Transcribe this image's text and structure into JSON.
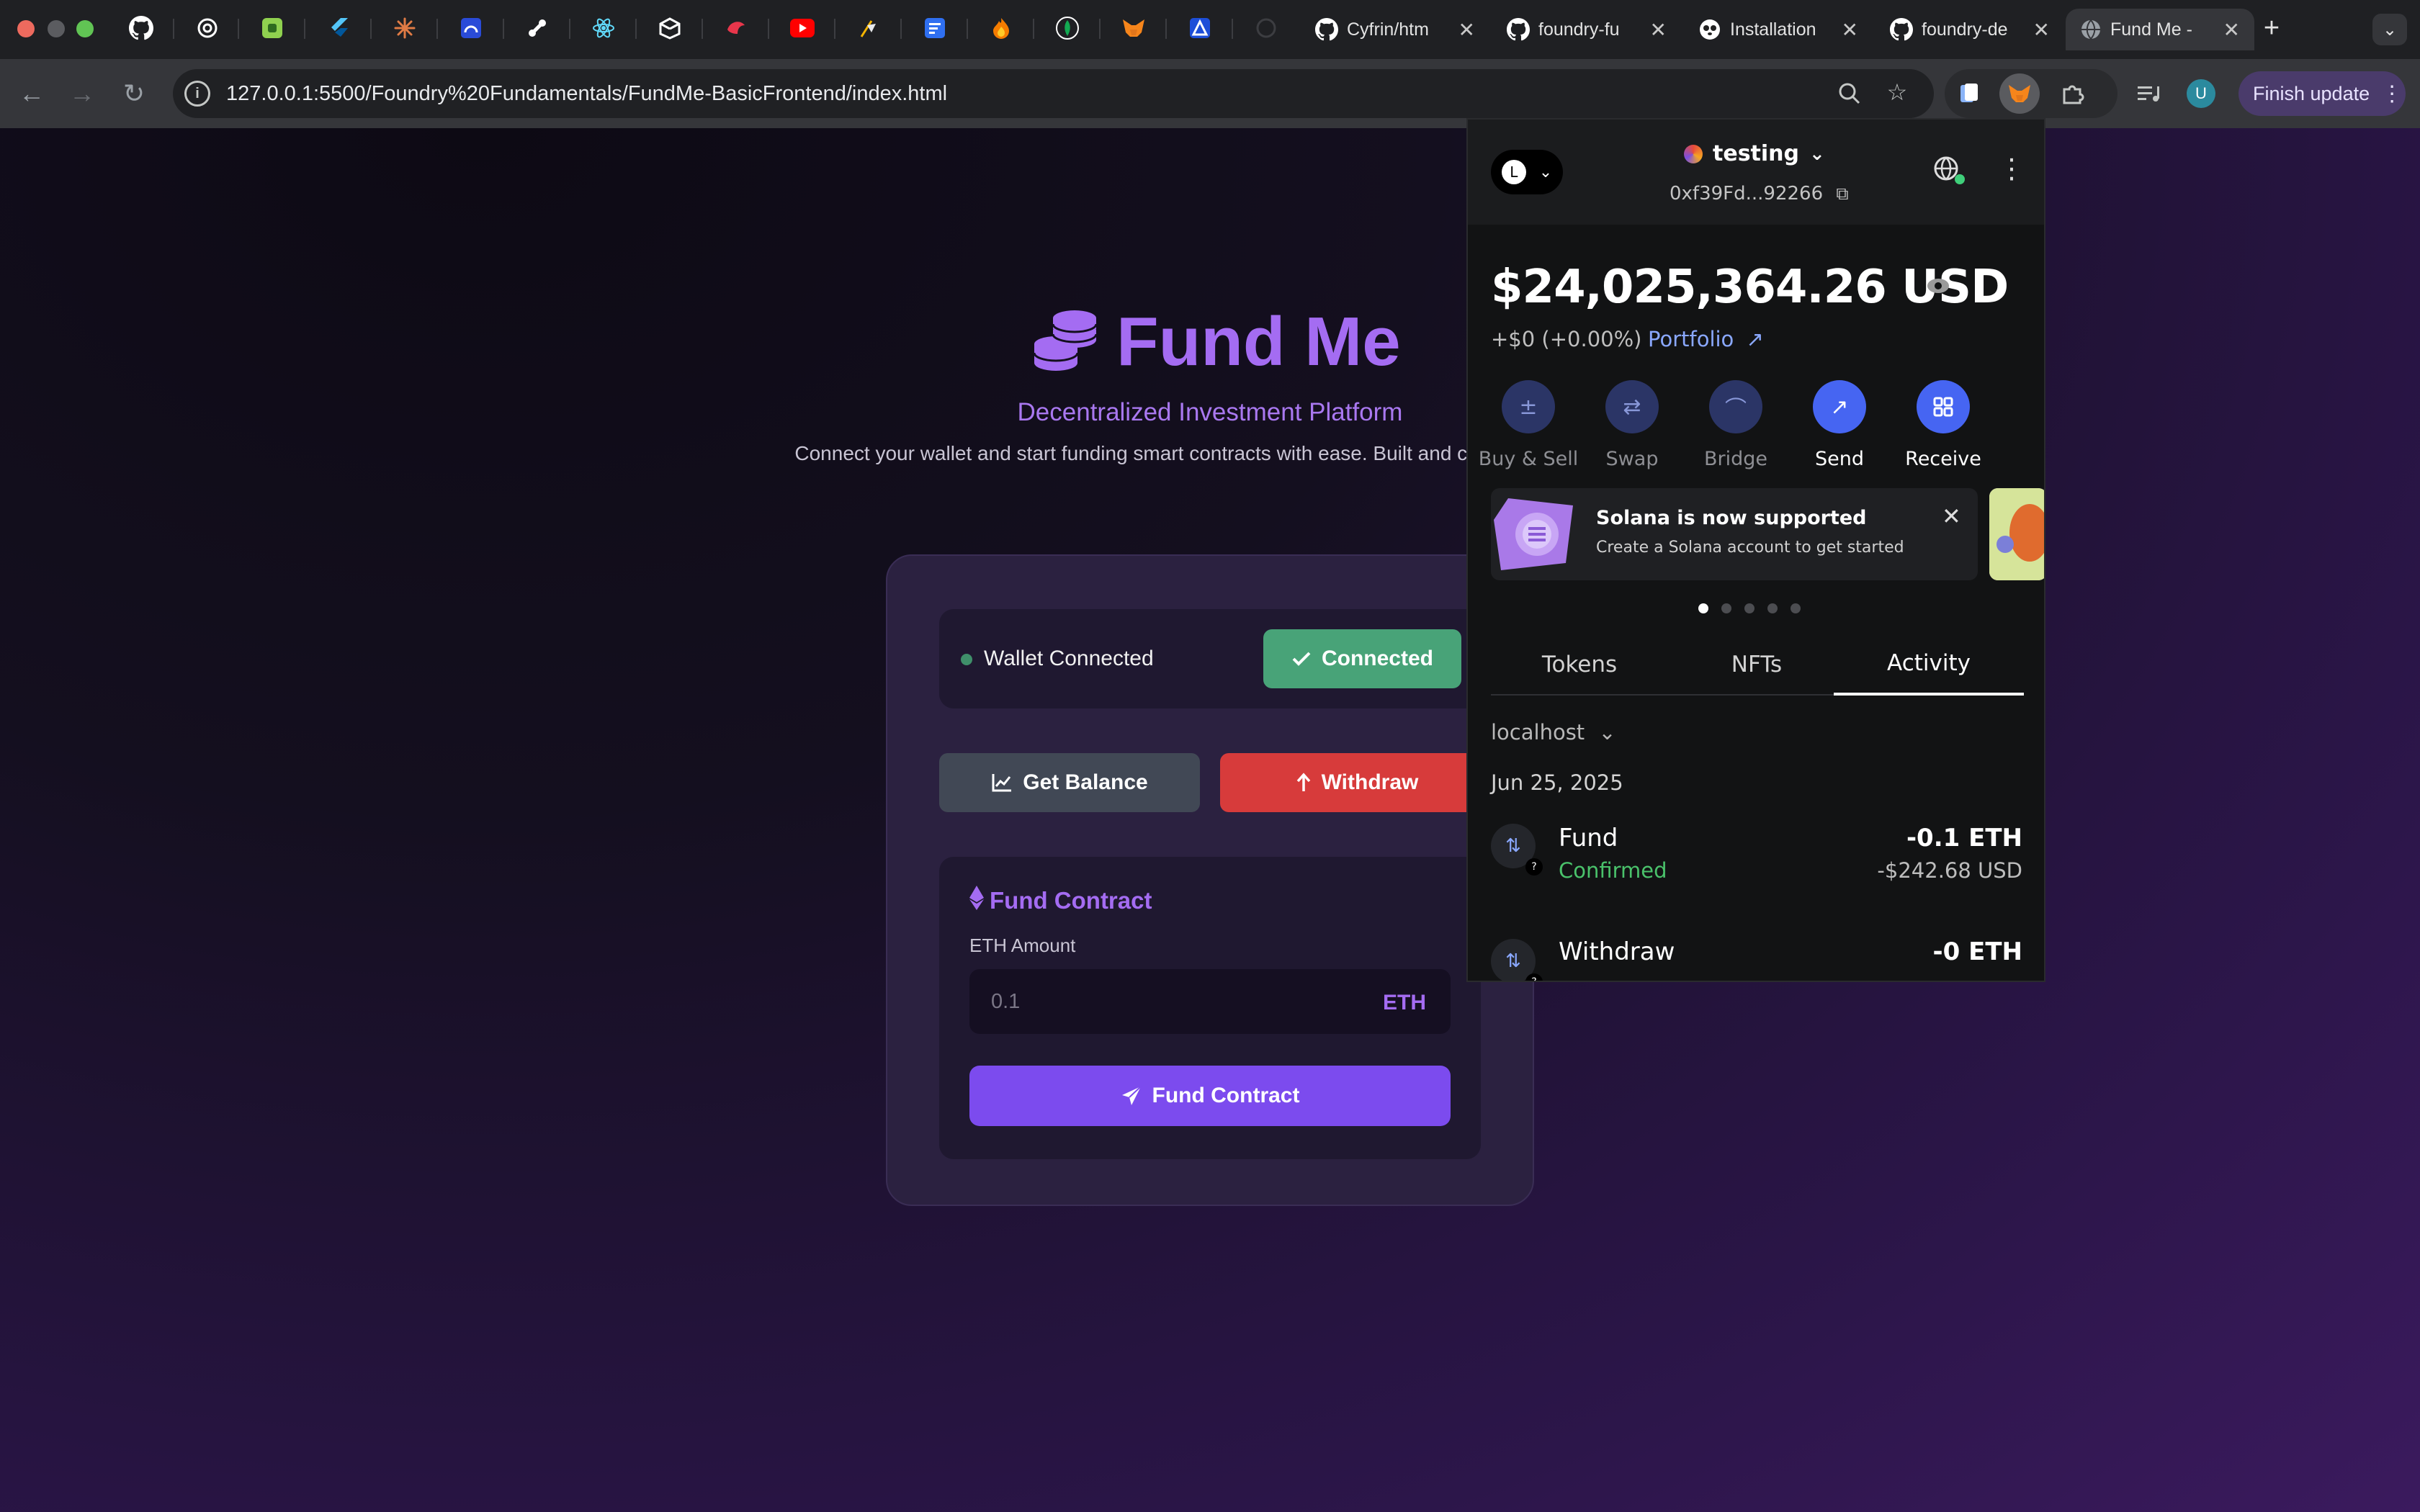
{
  "browser": {
    "tabs": [
      {
        "title": "Cyfrin/htm",
        "icon": "github-icon"
      },
      {
        "title": "foundry-fu",
        "icon": "github-icon"
      },
      {
        "title": "Installation",
        "icon": "panda-icon"
      },
      {
        "title": "foundry-de",
        "icon": "github-icon"
      },
      {
        "title": "Fund Me -",
        "icon": "globe-icon",
        "active": true
      }
    ],
    "url": "127.0.0.1:5500/Foundry%20Fundamentals/FundMe-BasicFrontend/index.html",
    "profile_initial": "U",
    "finish_update_label": "Finish update"
  },
  "app": {
    "title": "Fund Me",
    "subtitle": "Decentralized Investment Platform",
    "description": "Connect your wallet and start funding smart contracts with ease. Built and crypto enthusiasts.",
    "wallet_status": "Wallet Connected",
    "connected_label": "Connected",
    "get_balance_label": "Get Balance",
    "withdraw_label": "Withdraw",
    "fund_section_title": "Fund Contract",
    "eth_amount_label": "ETH Amount",
    "eth_placeholder": "0.1",
    "eth_unit": "ETH",
    "fund_button_label": "Fund Contract",
    "colors": {
      "accent": "#a46cf2",
      "connected": "#48a378",
      "withdraw": "#d73b3b",
      "fund": "#7c4bee"
    }
  },
  "metamask": {
    "network_initial": "L",
    "account_name": "testing",
    "address": "0xf39Fd...92266",
    "balance": "$24,025,364.26",
    "balance_unit": "USD",
    "change": "+$0 (+0.00%)",
    "portfolio_label": "Portfolio",
    "actions": [
      {
        "label": "Buy & Sell",
        "icon": "plus-minus-icon",
        "enabled": false
      },
      {
        "label": "Swap",
        "icon": "swap-icon",
        "enabled": false
      },
      {
        "label": "Bridge",
        "icon": "bridge-icon",
        "enabled": false
      },
      {
        "label": "Send",
        "icon": "arrow-up-right-icon",
        "enabled": true
      },
      {
        "label": "Receive",
        "icon": "qr-icon",
        "enabled": true
      }
    ],
    "banner": {
      "title": "Solana is now supported",
      "subtitle": "Create a Solana account to get started"
    },
    "carousel_count": 5,
    "carousel_active": 0,
    "tabs": [
      "Tokens",
      "NFTs",
      "Activity"
    ],
    "active_tab": "Activity",
    "network_filter": "localhost",
    "date": "Jun 25, 2025",
    "transactions": [
      {
        "name": "Fund",
        "status": "Confirmed",
        "amount": "-0.1 ETH",
        "usd": "-$242.68 USD"
      },
      {
        "name": "Withdraw",
        "status": "",
        "amount": "-0 ETH",
        "usd": ""
      }
    ]
  }
}
